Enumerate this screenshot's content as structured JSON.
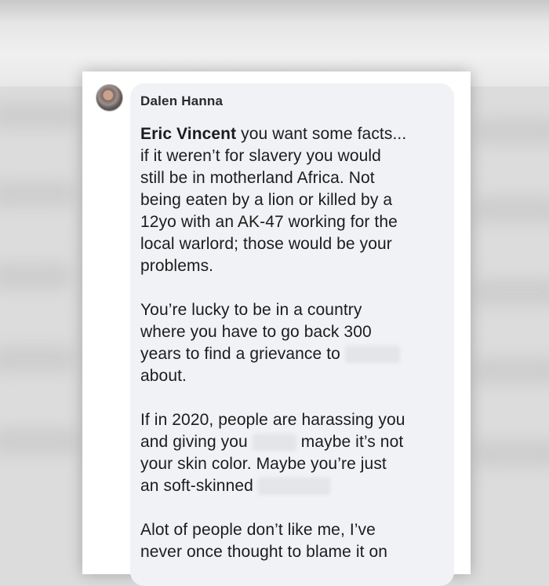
{
  "comment": {
    "author": "Dalen Hanna",
    "mention": "Eric Vincent",
    "p1_line1_rest": " you want some facts...",
    "p1_line2": "if it weren’t for slavery you would",
    "p1_line3": "still be in motherland Africa. Not",
    "p1_line4": "being eaten by a lion or killed by a",
    "p1_line5": "12yo with an AK-47 working for the",
    "p1_line6": "local warlord; those would be your",
    "p1_line7": "problems.",
    "p2_line1": "You’re lucky to be in a country",
    "p2_line2": "where you have to go back 300",
    "p2_line3": "years to find a grievance to",
    "p2_line4": "about.",
    "p3_line1": "If in 2020, people are harassing you",
    "p3_line2a": "and giving you",
    "p3_line2b": "maybe it’s not",
    "p3_line3": "your skin color. Maybe you’re just",
    "p3_line4": "an soft-skinned",
    "p4_line1": "Alot of people don’t like me, I’ve",
    "p4_line2": "never once thought to blame it on"
  }
}
